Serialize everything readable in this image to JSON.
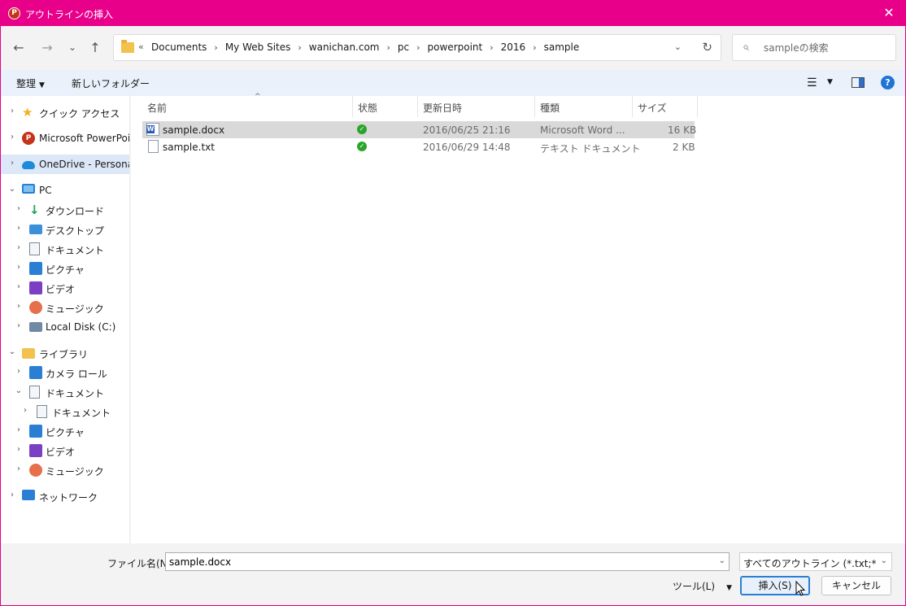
{
  "window": {
    "title": "アウトラインの挿入",
    "app_icon": "P",
    "close_glyph": "✕",
    "accent": "#e8008b"
  },
  "nav": {
    "back_glyph": "←",
    "forward_glyph": "→",
    "recent_glyph": "⌄",
    "up_glyph": "↑",
    "overflow_glyph": "«",
    "breadcrumbs": [
      "Documents",
      "My Web Sites",
      "wanichan.com",
      "pc",
      "powerpoint",
      "2016",
      "sample"
    ],
    "separator_glyph": "›",
    "dropdown_glyph": "⌄",
    "refresh_glyph": "↻"
  },
  "search": {
    "placeholder": "sampleの検索",
    "icon_glyph": "⌕"
  },
  "toolbar": {
    "organize_label": "整理",
    "caret_glyph": "▼",
    "new_folder_label": "新しいフォルダー",
    "view_glyph": "☰",
    "help_glyph": "?"
  },
  "sidebar": {
    "items": [
      {
        "label": "クイック アクセス",
        "icon": "star-icon",
        "expander": "›"
      },
      {
        "label": "Microsoft PowerPoir",
        "icon": "powerpoint-icon",
        "expander": "›",
        "badge": "P"
      },
      {
        "label": "OneDrive - Personal",
        "icon": "onedrive-icon",
        "expander": "›"
      },
      {
        "label": "PC",
        "icon": "pc-icon",
        "expander": "⌄"
      },
      {
        "label": "ダウンロード",
        "icon": "download-icon",
        "expander": "›",
        "glyph": "↓"
      },
      {
        "label": "デスクトップ",
        "icon": "desktop-icon",
        "expander": "›"
      },
      {
        "label": "ドキュメント",
        "icon": "documents-icon",
        "expander": "›"
      },
      {
        "label": "ピクチャ",
        "icon": "pictures-icon",
        "expander": "›"
      },
      {
        "label": "ビデオ",
        "icon": "videos-icon",
        "expander": "›"
      },
      {
        "label": "ミュージック",
        "icon": "music-icon",
        "expander": "›"
      },
      {
        "label": "Local Disk (C:)",
        "icon": "disk-icon",
        "expander": "›"
      },
      {
        "label": "ライブラリ",
        "icon": "library-icon",
        "expander": "⌄"
      },
      {
        "label": "カメラ ロール",
        "icon": "camera-roll-icon",
        "expander": "›"
      },
      {
        "label": "ドキュメント",
        "icon": "documents-icon",
        "expander": "⌄"
      },
      {
        "label": "ドキュメント",
        "icon": "documents-icon",
        "expander": "›"
      },
      {
        "label": "ピクチャ",
        "icon": "pictures-icon",
        "expander": "›"
      },
      {
        "label": "ビデオ",
        "icon": "videos-icon",
        "expander": "›"
      },
      {
        "label": "ミュージック",
        "icon": "music-icon",
        "expander": "›"
      },
      {
        "label": "ネットワーク",
        "icon": "network-icon",
        "expander": "›"
      }
    ],
    "selected_index": 2
  },
  "filelist": {
    "columns": [
      "名前",
      "状態",
      "更新日時",
      "種類",
      "サイズ"
    ],
    "sort_glyph": "^",
    "status_glyph": "✓",
    "rows": [
      {
        "name": "sample.docx",
        "icon": "word-file-icon",
        "date": "2016/06/25 21:16",
        "type": "Microsoft Word ...",
        "size": "16 KB",
        "selected": true
      },
      {
        "name": "sample.txt",
        "icon": "text-file-icon",
        "date": "2016/06/29 14:48",
        "type": "テキスト ドキュメント",
        "size": "2 KB",
        "selected": false
      }
    ]
  },
  "footer": {
    "filename_label": "ファイル名(N):",
    "filename_value": "sample.docx",
    "dropdown_glyph": "⌄",
    "filetype_value": "すべてのアウトライン (*.txt;*.rtf;*.docx)",
    "tools_label": "ツール(L)",
    "insert_label": "挿入(S)",
    "cancel_label": "キャンセル"
  }
}
